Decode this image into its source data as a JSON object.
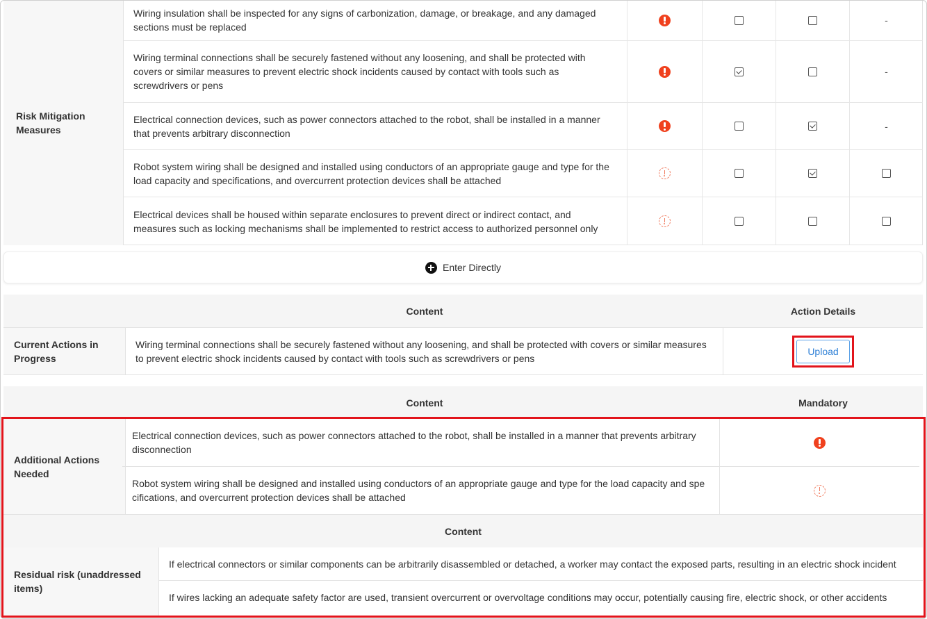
{
  "risk_mitigation": {
    "label": "Risk Mitigation Measures",
    "rows": [
      {
        "text": "Wiring insulation shall be inspected for any signs of carbonization, damage, or breakage, and any damaged sections must be replaced",
        "severity": "mandatory",
        "col1": "unchecked",
        "col2": "unchecked",
        "col3": "-"
      },
      {
        "text": "Wiring terminal connections shall be securely fastened without any loosening, and shall be protected with covers or similar measures to prevent electric shock incidents caused by contact with tools such as screwdrivers or pens",
        "severity": "mandatory",
        "col1": "checked",
        "col2": "unchecked",
        "col3": "-"
      },
      {
        "text": "Electrical connection devices, such as power connectors attached to the robot, shall be installed in a manner that prevents arbitrary disconnection",
        "severity": "mandatory",
        "col1": "unchecked",
        "col2": "checked",
        "col3": "-"
      },
      {
        "text": "Robot system wiring shall be designed and installed using conductors of an appropriate gauge and type for the load capacity and specifications, and overcurrent protection devices shall be attached",
        "severity": "recommended",
        "col1": "unchecked",
        "col2": "checked",
        "col3": "unchecked"
      },
      {
        "text": "Electrical devices shall be housed within separate enclosures to prevent direct or indirect contact, and measures such as locking mechanisms shall be implemented to restrict access to authorized personnel only",
        "severity": "recommended",
        "col1": "unchecked",
        "col2": "unchecked",
        "col3": "unchecked"
      }
    ]
  },
  "enter_directly": {
    "label": "Enter Directly",
    "icon": "plus-circle-icon"
  },
  "current_actions": {
    "header_content": "Content",
    "header_action": "Action Details",
    "label": "Current Actions in Progress",
    "text": "Wiring terminal connections shall be securely fastened without any loosening, and shall be protected with covers or similar measures to prevent electric shock incidents caused by contact with tools such as screwdrivers or pens",
    "upload_label": "Upload"
  },
  "additional_actions": {
    "header_content": "Content",
    "header_mandatory": "Mandatory",
    "label": "Additional Actions Needed",
    "rows": [
      {
        "text": "Electrical connection devices, such as power connectors attached to the robot, shall be installed in a manner that prevents arbitrary disconnection",
        "severity": "mandatory"
      },
      {
        "text": "Robot system wiring shall be designed and installed using conductors of an appropriate gauge and type for the load capacity and spe cifications, and overcurrent protection devices shall be attached",
        "severity": "recommended"
      }
    ]
  },
  "residual_risk": {
    "header_content": "Content",
    "label": "Residual risk (unaddressed items)",
    "rows": [
      "If electrical connectors or similar components can be arbitrarily disassembled or detached, a worker may contact the exposed parts, resulting in an electric shock incident",
      "If wires lacking an adequate safety factor are used, transient overcurrent or overvoltage conditions may occur, potentially causing fire, electric shock, or other accidents"
    ]
  },
  "colors": {
    "highlight": "#e2141b",
    "alert": "#f0411e",
    "link": "#2f80d6"
  }
}
